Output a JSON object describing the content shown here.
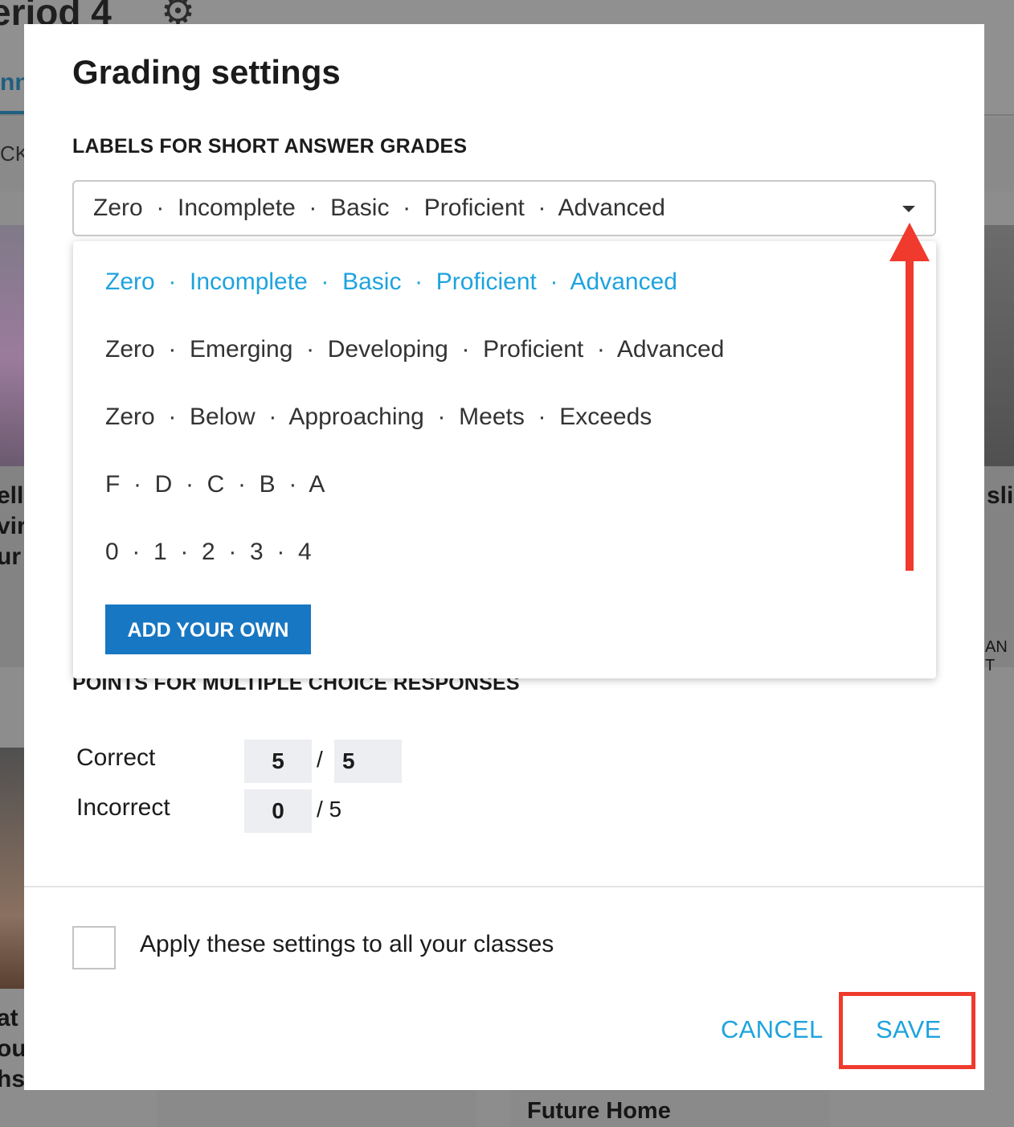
{
  "background": {
    "page_title": "eriod 4",
    "tab_label": "nn",
    "back_label": "CK",
    "card_left_1": [
      "ell",
      "vir",
      "ur"
    ],
    "card_right_1": [
      "sli"
    ],
    "card_right_1_meta": "AN T",
    "card_left_2": [
      "at",
      "ou",
      "hs"
    ],
    "card_bottom_title": "Future Home"
  },
  "modal": {
    "title": "Grading settings",
    "short_answer": {
      "section_label": "LABELS FOR SHORT ANSWER GRADES",
      "selected_value": "Zero  ·  Incomplete  ·  Basic  ·  Proficient  ·  Advanced",
      "options": [
        "Zero  ·  Incomplete  ·  Basic  ·  Proficient  ·  Advanced",
        "Zero  ·  Emerging  ·  Developing  ·  Proficient  ·  Advanced",
        "Zero  ·  Below  ·  Approaching  ·  Meets  ·  Exceeds",
        "F  ·  D  ·  C  ·  B  ·  A",
        "0  ·  1  ·  2  ·  3  ·  4"
      ],
      "add_own_label": "ADD YOUR OWN"
    },
    "multiple_choice": {
      "section_label": "POINTS FOR MULTIPLE CHOICE RESPONSES",
      "correct_label": "Correct",
      "correct_value": "5",
      "correct_max": "5",
      "incorrect_label": "Incorrect",
      "incorrect_value": "0",
      "incorrect_max": "/ 5"
    },
    "apply_all_label": "Apply these settings to all your classes",
    "apply_all_checked": false,
    "cancel_label": "CANCEL",
    "save_label": "SAVE"
  },
  "colors": {
    "accent": "#1ea3de",
    "button_blue": "#1877c2",
    "annotation_red": "#ef3a2d"
  },
  "icons": {
    "gear": "gear-icon",
    "caret": "caret-down-icon",
    "annotation_arrow": "arrow-up-icon"
  }
}
